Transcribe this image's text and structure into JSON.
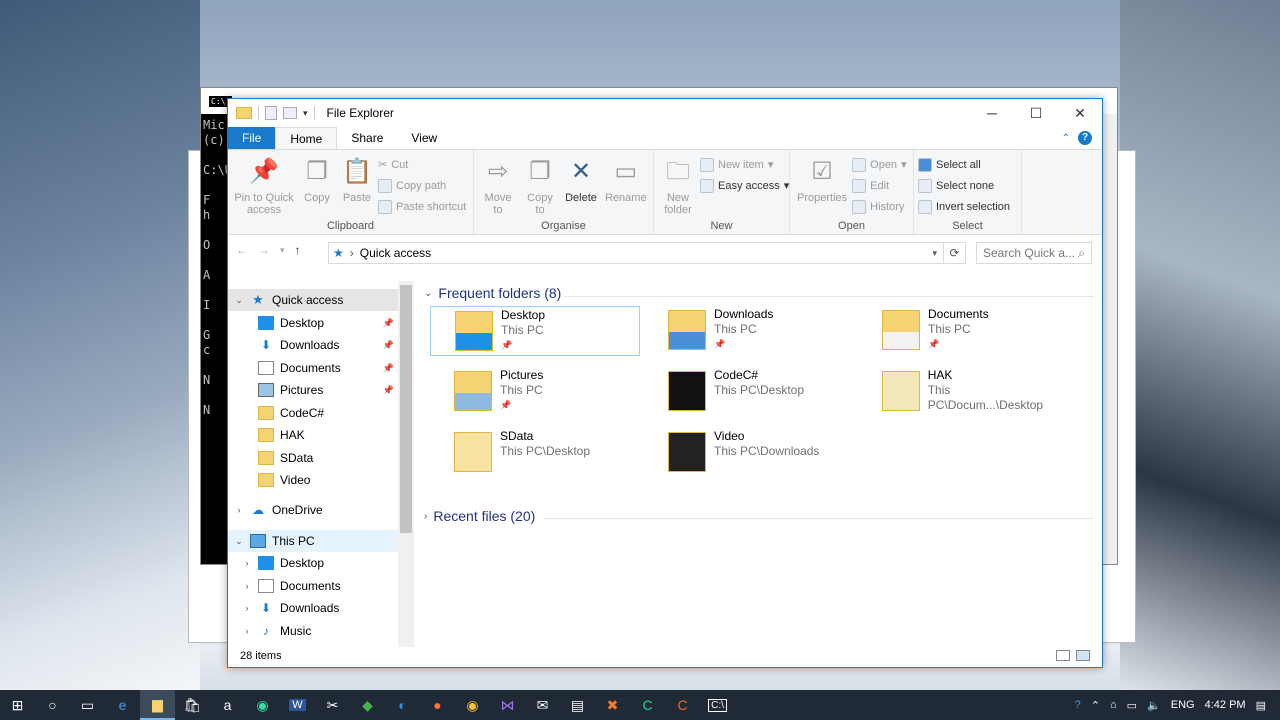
{
  "console": {
    "icon": "C:\\.",
    "lines": [
      "Mic",
      "(c)",
      "",
      "C:\\U",
      "",
      "F",
      "h",
      "",
      "O",
      "",
      "A",
      "",
      "I",
      "",
      "G",
      "c",
      "",
      "N",
      "",
      "N"
    ]
  },
  "explorer": {
    "title": "File Explorer",
    "tabs": {
      "file": "File",
      "home": "Home",
      "share": "Share",
      "view": "View"
    },
    "ribbon": {
      "clipboard": {
        "label": "Clipboard",
        "pin": "Pin to Quick access",
        "copy": "Copy",
        "paste": "Paste",
        "cut": "Cut",
        "copy_path": "Copy path",
        "paste_shortcut": "Paste shortcut"
      },
      "organise": {
        "label": "Organise",
        "move_to": "Move to",
        "copy_to": "Copy to",
        "delete": "Delete",
        "rename": "Rename"
      },
      "new": {
        "label": "New",
        "new_folder": "New folder",
        "new_item": "New item",
        "easy_access": "Easy access"
      },
      "open": {
        "label": "Open",
        "properties": "Properties",
        "open": "Open",
        "edit": "Edit",
        "history": "History"
      },
      "select": {
        "label": "Select",
        "select_all": "Select all",
        "select_none": "Select none",
        "invert": "Invert selection"
      }
    },
    "address": {
      "path": "Quick access",
      "search_placeholder": "Search Quick a..."
    },
    "nav": [
      {
        "label": "Quick access",
        "top": 0,
        "type": "star"
      },
      {
        "label": "Desktop",
        "pinned": true,
        "type": "desktop"
      },
      {
        "label": "Downloads",
        "pinned": true,
        "type": "download"
      },
      {
        "label": "Documents",
        "pinned": true,
        "type": "doc"
      },
      {
        "label": "Pictures",
        "pinned": true,
        "type": "pic"
      },
      {
        "label": "CodeC#",
        "type": "folder"
      },
      {
        "label": "HAK",
        "type": "folder"
      },
      {
        "label": "SData",
        "type": "folder"
      },
      {
        "label": "Video",
        "type": "folder"
      },
      {
        "label": "OneDrive",
        "type": "cloud"
      },
      {
        "label": "This PC",
        "type": "pc"
      },
      {
        "label": "Desktop",
        "type": "desktop"
      },
      {
        "label": "Documents",
        "type": "doc"
      },
      {
        "label": "Downloads",
        "type": "download"
      },
      {
        "label": "Music",
        "type": "music"
      }
    ],
    "sections": {
      "frequent": "Frequent folders (8)",
      "recent": "Recent files (20)"
    },
    "tiles": [
      {
        "name": "Desktop",
        "path": "This PC",
        "pinned": true
      },
      {
        "name": "Downloads",
        "path": "This PC",
        "pinned": true
      },
      {
        "name": "Documents",
        "path": "This PC",
        "pinned": true
      },
      {
        "name": "Pictures",
        "path": "This PC",
        "pinned": true
      },
      {
        "name": "CodeC#",
        "path": "This PC\\Desktop",
        "pinned": false
      },
      {
        "name": "HAK",
        "path": "This PC\\Docum...\\Desktop",
        "pinned": false
      },
      {
        "name": "SData",
        "path": "This PC\\Desktop",
        "pinned": false
      },
      {
        "name": "Video",
        "path": "This PC\\Downloads",
        "pinned": false
      }
    ],
    "status": "28 items"
  },
  "taskbar": {
    "lang": "ENG",
    "time": "4:42 PM"
  }
}
